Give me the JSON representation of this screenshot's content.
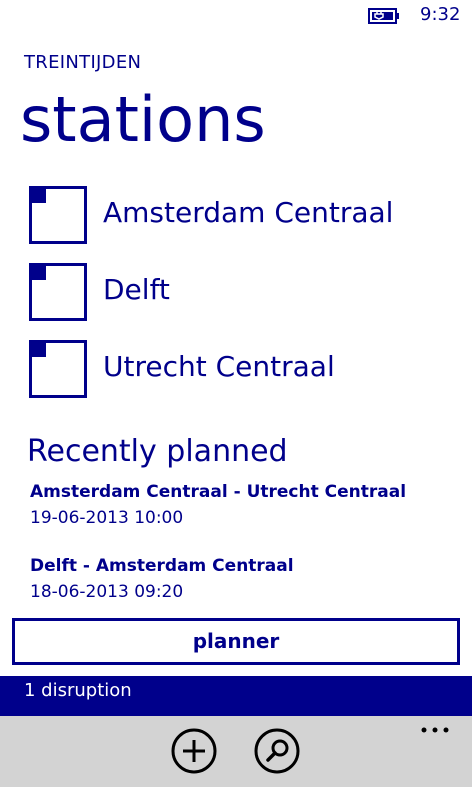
{
  "status_bar": {
    "time": "9:32",
    "icons": [
      "battery-charging-icon"
    ]
  },
  "app": {
    "title": "TREINTIJDEN"
  },
  "page": {
    "title": "stations"
  },
  "stations": [
    {
      "label": "Amsterdam Centraal"
    },
    {
      "label": "Delft"
    },
    {
      "label": "Utrecht Centraal"
    }
  ],
  "recent": {
    "heading": "Recently planned",
    "items": [
      {
        "route": "Amsterdam Centraal - Utrecht Centraal",
        "date": "19-06-2013 10:00"
      },
      {
        "route": "Delft - Amsterdam Centraal",
        "date": "18-06-2013 09:20"
      }
    ]
  },
  "planner_button": {
    "label": "planner"
  },
  "disruption": {
    "text": "1 disruption"
  },
  "app_bar": {
    "buttons": [
      {
        "icon": "add-icon"
      },
      {
        "icon": "search-icon"
      }
    ],
    "more_icon": "more-icon"
  },
  "colors": {
    "accent": "#00008b",
    "app_bar": "#d3d3d3",
    "background": "#ffffff"
  }
}
